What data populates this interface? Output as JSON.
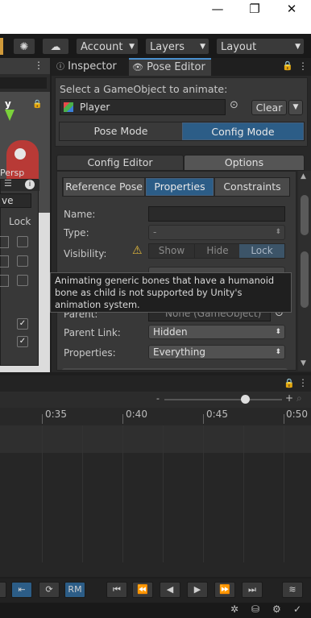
{
  "window": {
    "minimize_icon": "—",
    "restore_icon": "❐",
    "close_icon": "✕"
  },
  "toolbar": {
    "account_label": "Account",
    "layers_label": "Layers",
    "layout_label": "Layout"
  },
  "scene": {
    "axis_label": "y",
    "persp_label": "Persp",
    "ve_text": "ve",
    "lock_label": "Lock"
  },
  "tabs": {
    "inspector": "Inspector",
    "pose_editor": "Pose Editor"
  },
  "pose_editor": {
    "select_label": "Select a GameObject to animate:",
    "target_object": "Player",
    "clear_label": "Clear",
    "mode_pose": "Pose Mode",
    "mode_config": "Config Mode",
    "subtab_config_editor": "Config Editor",
    "subtab_options": "Options",
    "inner_tabs": {
      "reference_pose": "Reference Pose",
      "properties": "Properties",
      "constraints": "Constraints"
    },
    "fields": {
      "name_label": "Name:",
      "name_value": "",
      "type_label": "Type:",
      "type_value": "-",
      "visibility_label": "Visibility:",
      "vis_show": "Show",
      "vis_hide": "Hide",
      "vis_lock": "Lock",
      "parent_label": "Parent:",
      "parent_value": "None (GameObject)",
      "parent_link_label": "Parent Link:",
      "parent_link_value": "Hidden",
      "properties_label": "Properties:",
      "properties_value": "Everything"
    },
    "tooltip": "Animating generic bones that have a humanoid bone as child is not supported by Unity's animation system."
  },
  "timeline": {
    "ticks": [
      "0:35",
      "0:40",
      "0:45",
      "0:50"
    ]
  },
  "bottom": {
    "rm_label": "RM"
  }
}
